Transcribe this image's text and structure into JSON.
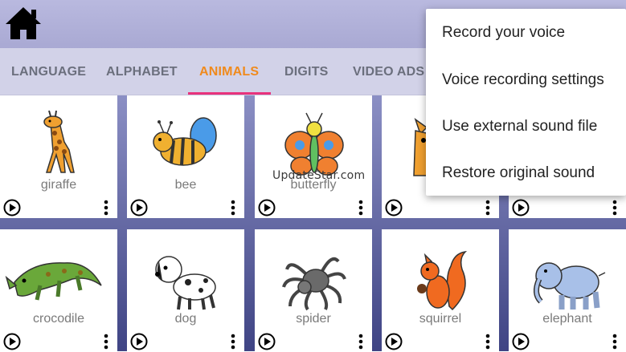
{
  "header": {
    "home_icon": "home-icon"
  },
  "tabs": [
    {
      "label": "LANGUAGE"
    },
    {
      "label": "ALPHABET"
    },
    {
      "label": "ANIMALS",
      "active": true
    },
    {
      "label": "DIGITS"
    },
    {
      "label": "VIDEO ADS"
    }
  ],
  "colors": {
    "accent": "#f08a1c",
    "tab_indicator": "#e8327c",
    "toolbar": "#b3b3d9"
  },
  "cards": [
    {
      "label": "giraffe"
    },
    {
      "label": "bee"
    },
    {
      "label": "butterfly"
    },
    {
      "label": ""
    },
    {
      "label": ""
    },
    {
      "label": "crocodile"
    },
    {
      "label": "dog"
    },
    {
      "label": "spider"
    },
    {
      "label": "squirrel"
    },
    {
      "label": "elephant"
    }
  ],
  "watermark": "UpdateStar.com",
  "menu": {
    "items": [
      {
        "label": "Record your voice"
      },
      {
        "label": "Voice recording settings"
      },
      {
        "label": "Use external sound file"
      },
      {
        "label": "Restore original sound"
      }
    ]
  }
}
